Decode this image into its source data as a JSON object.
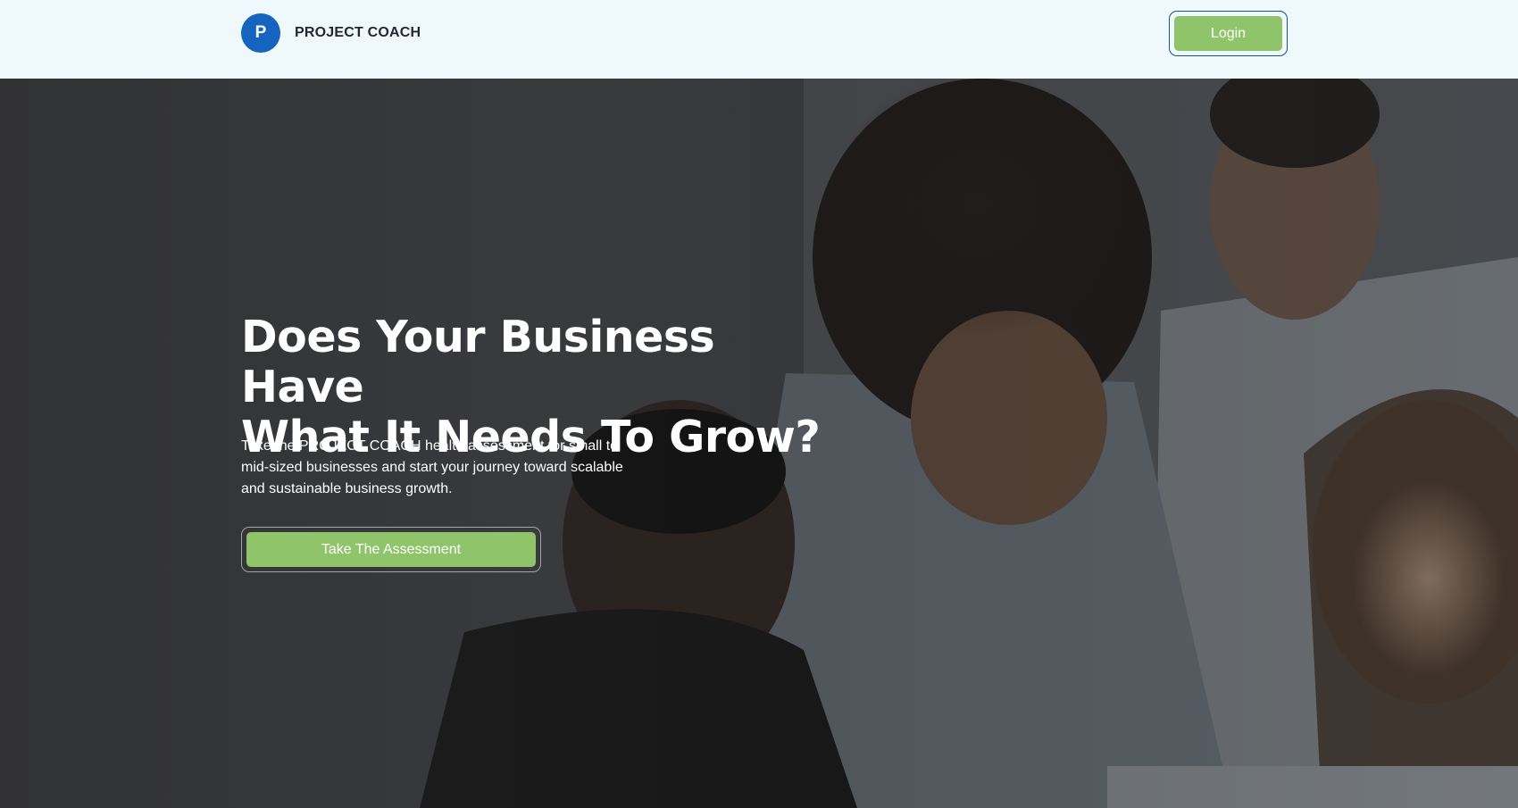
{
  "header": {
    "logo_letter": "P",
    "brand_name": "PROJECT COACH",
    "login_label": "Login"
  },
  "hero": {
    "title_line1": "Does Your Business Have",
    "title_line2": "What It Needs To Grow?",
    "description": "Take the PROJECT COACH health assessment for small to mid-sized businesses and start your journey toward scalable and sustainable business growth.",
    "cta_label": "Take The Assessment"
  },
  "colors": {
    "header_bg": "#eff8fb",
    "brand_blue": "#1565c0",
    "button_green": "#8fc46a",
    "login_border": "#1d4f91"
  }
}
